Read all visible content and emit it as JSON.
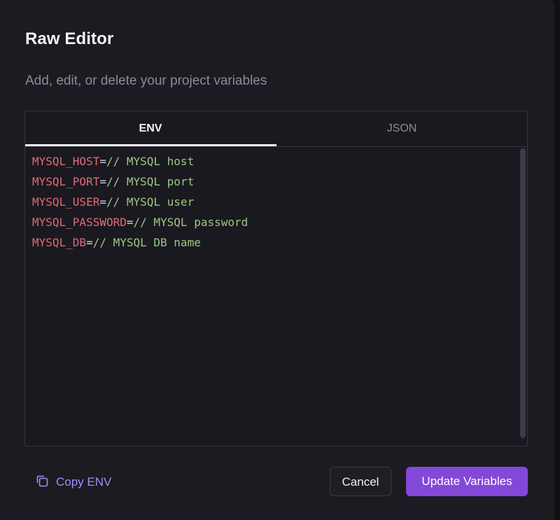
{
  "dialog": {
    "title": "Raw Editor",
    "subtitle": "Add, edit, or delete your project variables"
  },
  "tabs": [
    {
      "label": "ENV",
      "active": true
    },
    {
      "label": "JSON",
      "active": false
    }
  ],
  "editor": {
    "lines": [
      {
        "key": "MYSQL_HOST",
        "eq": "=",
        "comment": "// MYSQL host"
      },
      {
        "key": "MYSQL_PORT",
        "eq": "=",
        "comment": "// MYSQL port"
      },
      {
        "key": "MYSQL_USER",
        "eq": "=",
        "comment": "// MYSQL user"
      },
      {
        "key": "MYSQL_PASSWORD",
        "eq": "=",
        "comment": "// MYSQL password"
      },
      {
        "key": "MYSQL_DB",
        "eq": "=",
        "comment": "// MYSQL DB name"
      }
    ]
  },
  "footer": {
    "copy_label": "Copy ENV",
    "cancel_label": "Cancel",
    "update_label": "Update Variables"
  },
  "colors": {
    "accent": "#8348d8",
    "key": "#e06a78",
    "comment": "#9bc883",
    "background": "#1c1b22"
  },
  "icons": {
    "copy": "copy-icon"
  }
}
